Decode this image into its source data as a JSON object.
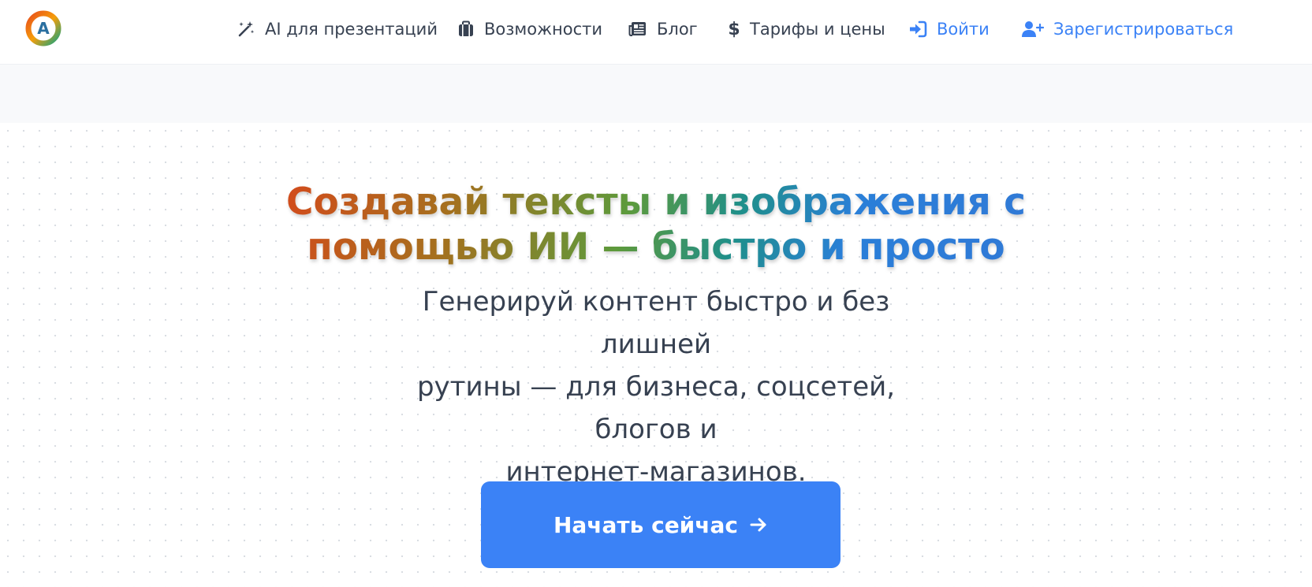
{
  "header": {
    "logo_letter": "A",
    "nav": {
      "presentations": "AI для презентаций",
      "features": "Возможности",
      "blog": "Блог",
      "pricing": "Тарифы и цены",
      "login": "Войти",
      "register": "Зарегистрироваться"
    },
    "icons": {
      "presentations": "magic-wand-icon",
      "features": "briefcase-icon",
      "blog": "newspaper-icon",
      "pricing": "dollar-icon",
      "login": "sign-in-icon",
      "register": "user-plus-icon"
    }
  },
  "hero": {
    "title_line1": "Создавай тексты и изображения с",
    "title_line2": "помощью ИИ — быстро и просто",
    "subtitle_line1": "Генерируй контент быстро и без лишней",
    "subtitle_line2": "рутины — для бизнеса, соцсетей, блогов и",
    "subtitle_line3": "интернет-магазинов.",
    "cta_label": "Начать сейчас"
  },
  "colors": {
    "accent": "#3b82f6",
    "nav_text": "#374151",
    "band": "#f8f9fb",
    "title_gradient": [
      "#d9461b",
      "#a5701e",
      "#5d9a3c",
      "#1f8f8a",
      "#2a7fd8"
    ]
  }
}
